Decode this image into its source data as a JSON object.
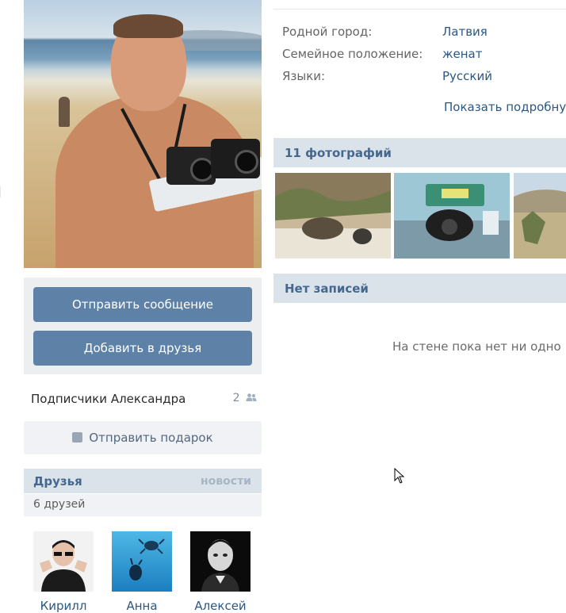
{
  "profile": {
    "info": [
      {
        "label": "Родной город:",
        "value": "Латвия"
      },
      {
        "label": "Семейное положение:",
        "value": "женат"
      },
      {
        "label": "Языки:",
        "value": "Русский"
      }
    ],
    "show_more": "Показать подробнук"
  },
  "actions": {
    "send_message": "Отправить сообщение",
    "add_friend": "Добавить в друзья"
  },
  "followers": {
    "label": "Подписчики Александра",
    "count": "2"
  },
  "gift": {
    "label": "Отправить подарок"
  },
  "friends": {
    "title": "Друзья",
    "news_link": "новости",
    "count_label": "6 друзей",
    "items": [
      {
        "name": "Кирилл"
      },
      {
        "name": "Анна"
      },
      {
        "name": "Алексей"
      }
    ]
  },
  "photos": {
    "title": "11 фотографий"
  },
  "wall": {
    "title": "Нет записей",
    "empty_text": "На стене пока нет ни одно"
  },
  "colors": {
    "accent": "#5e81a8",
    "link": "#2a5885",
    "section_bg": "#dae2ea",
    "box_bg": "#edeef0"
  }
}
